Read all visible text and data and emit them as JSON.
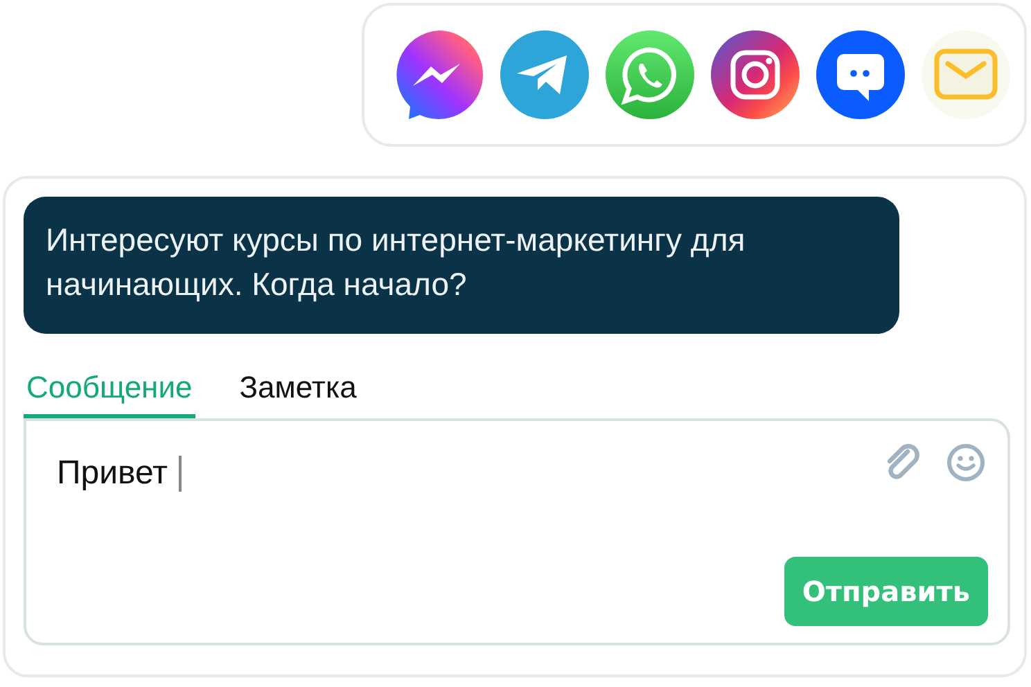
{
  "channels": [
    {
      "kind": "messenger"
    },
    {
      "kind": "telegram"
    },
    {
      "kind": "whatsapp"
    },
    {
      "kind": "instagram"
    },
    {
      "kind": "chat"
    },
    {
      "kind": "email"
    }
  ],
  "message": {
    "text": "Интересуют курсы по интернет-маркетингу для начинающих. Когда начало?"
  },
  "tabs": [
    {
      "label": "Сообщение",
      "selected": true
    },
    {
      "label": "Заметка",
      "selected": false
    }
  ],
  "composer": {
    "value": "Привет",
    "send_button": "Отправить"
  }
}
